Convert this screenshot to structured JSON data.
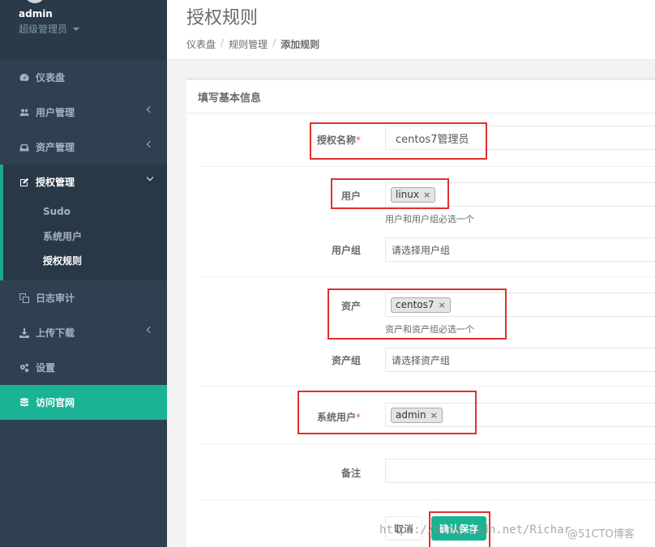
{
  "sidebar": {
    "profile": {
      "username": "admin",
      "role": "超级管理员"
    },
    "items": [
      {
        "label": "仪表盘",
        "icon": "dashboard-icon"
      },
      {
        "label": "用户管理",
        "icon": "users-icon"
      },
      {
        "label": "资产管理",
        "icon": "inbox-icon"
      },
      {
        "label": "授权管理",
        "icon": "edit-icon"
      },
      {
        "label": "日志审计",
        "icon": "copy-icon"
      },
      {
        "label": "上传下载",
        "icon": "download-icon"
      },
      {
        "label": "设置",
        "icon": "gears-icon"
      },
      {
        "label": "访问官网",
        "icon": "database-icon"
      }
    ],
    "subitems": [
      {
        "label": "Sudo"
      },
      {
        "label": "系统用户"
      },
      {
        "label": "授权规则"
      }
    ]
  },
  "header": {
    "title": "授权规则",
    "breadcrumb": [
      "仪表盘",
      "规则管理",
      "添加规则"
    ],
    "separator": "/"
  },
  "form": {
    "panel_title": "填写基本信息",
    "name_label": "授权名称",
    "name_value": "centos7管理员",
    "user_label": "用户",
    "user_tag": "linux",
    "user_help": "用户和用户组必选一个",
    "usergroup_label": "用户组",
    "usergroup_placeholder": "请选择用户组",
    "asset_label": "资产",
    "asset_tag": "centos7",
    "asset_help": "资产和资产组必选一个",
    "assetgroup_label": "资产组",
    "assetgroup_placeholder": "请选择资产组",
    "sysuser_label": "系统用户",
    "sysuser_tag": "admin",
    "comment_label": "备注",
    "required_mark": "*",
    "tag_remove": "×",
    "cancel": "取消",
    "save": "确认保存"
  },
  "watermark": {
    "url": "https://blog.csdn.net/Richar",
    "brand": "@51CTO博客"
  },
  "colors": {
    "sidebar_bg": "#2f4050",
    "accent": "#1ab394",
    "highlight_box": "#e0302e",
    "required": "#ed5565"
  }
}
